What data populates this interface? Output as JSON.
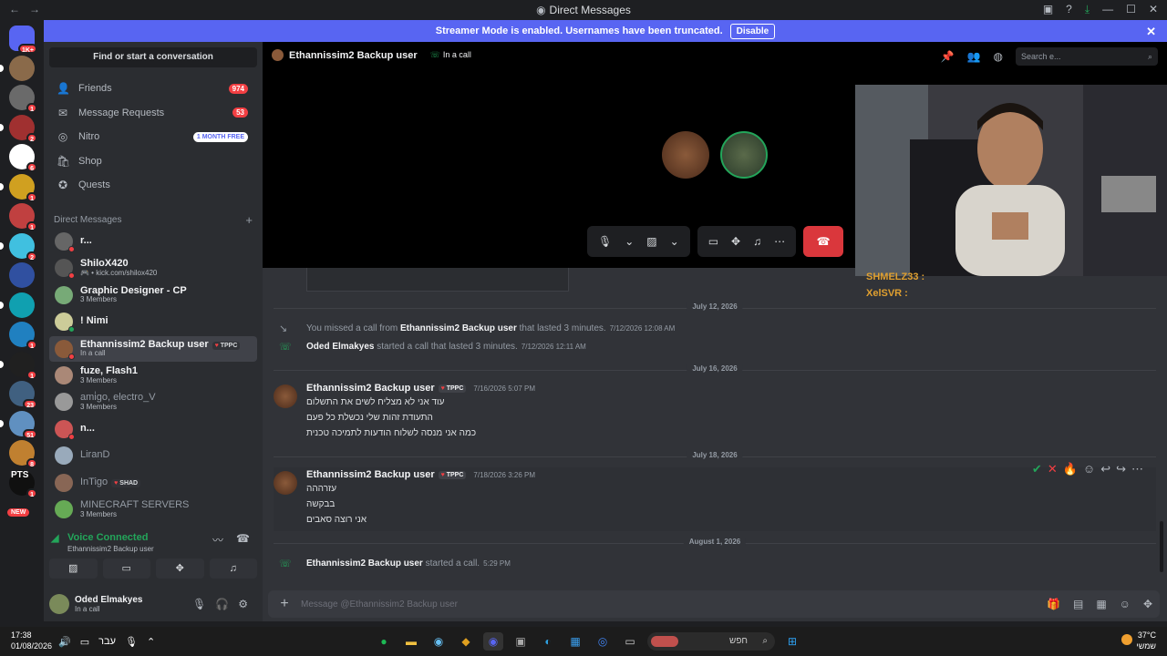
{
  "titlebar": {
    "title": "Direct Messages",
    "title_icon": "discord-icon",
    "nav_back": "←",
    "nav_fwd": "→"
  },
  "banner": {
    "text": "Streamer Mode is enabled. Usernames have been truncated.",
    "button": "Disable"
  },
  "servers": [
    {
      "badge": "1K+",
      "color": "#5865f2"
    },
    {
      "badge": "",
      "color": "#8a6a4a"
    },
    {
      "badge": "1",
      "color": "#6a6a6a"
    },
    {
      "badge": "2",
      "color": "#a03030"
    },
    {
      "badge": "6",
      "color": "#ffffff"
    },
    {
      "badge": "1",
      "color": "#d0a020"
    },
    {
      "badge": "1",
      "color": "#c04040"
    },
    {
      "badge": "2",
      "color": "#40c0e0"
    },
    {
      "badge": "",
      "color": "#3050a0"
    },
    {
      "badge": "",
      "color": "#10a0b0"
    },
    {
      "badge": "1",
      "color": "#2080c0"
    },
    {
      "badge": "1",
      "color": "#202020"
    },
    {
      "badge": "23",
      "color": "#406080"
    },
    {
      "badge": "51",
      "color": "#6090c0"
    },
    {
      "badge": "8",
      "color": "#c08030"
    },
    {
      "badge": "1",
      "color": "#101010"
    }
  ],
  "servers_pts": "PTS",
  "servers_new": "NEW",
  "sidebar": {
    "find": "Find or start a conversation",
    "nav": [
      {
        "label": "Friends",
        "icon": "friends-icon",
        "glyph": "👤",
        "count": "974"
      },
      {
        "label": "Message Requests",
        "icon": "mail-icon",
        "glyph": "✉",
        "count": "53"
      },
      {
        "label": "Nitro",
        "icon": "nitro-icon",
        "glyph": "◎",
        "promo": "1 MONTH FREE"
      },
      {
        "label": "Shop",
        "icon": "shop-icon",
        "glyph": "🛍"
      },
      {
        "label": "Quests",
        "icon": "quests-icon",
        "glyph": "✪"
      }
    ],
    "dm_header": "Direct Messages",
    "dms": [
      {
        "name": "r...",
        "sub": "",
        "color": "#666",
        "status": "#f23f43"
      },
      {
        "name": "ShiloX420",
        "sub": "🎮 • kick.com/shilox420",
        "color": "#555",
        "status": "#f23f43"
      },
      {
        "name": "Graphic Designer - CP",
        "sub": "3 Members",
        "color": "#7a7",
        "status": ""
      },
      {
        "name": "! Nimi",
        "sub": "",
        "color": "#cc9",
        "status": "#23a55a"
      },
      {
        "name": "Ethannissim2 Backup user",
        "sub": "In a call",
        "color": "#8a5a3a",
        "status": "#f23f43",
        "tag": "TPPC",
        "selected": true
      },
      {
        "name": "fuze, Flash1",
        "sub": "3 Members",
        "color": "#a87",
        "status": ""
      },
      {
        "name": "ami̇go, electro_V",
        "sub": "3 Members",
        "color": "#999",
        "status": "",
        "dim": true
      },
      {
        "name": "n...",
        "sub": "",
        "color": "#c55",
        "status": "#f23f43"
      },
      {
        "name": "LiranD",
        "sub": "",
        "color": "#9ab",
        "status": "",
        "dim": true
      },
      {
        "name": "InTigo",
        "sub": "",
        "color": "#865",
        "status": "",
        "dim": true,
        "tag": "SHAD"
      },
      {
        "name": "MINECRAFT SERVERS",
        "sub": "3 Members",
        "color": "#6a5",
        "status": "",
        "dim": true
      }
    ],
    "voice": {
      "status": "Voice Connected",
      "channel": "Ethannissim2 Backup user"
    },
    "user": {
      "name": "Oded Elmakyes",
      "sub": "In a call"
    }
  },
  "channel": {
    "name": "Ethannissim2 Backup user",
    "status": "In a call",
    "search_placeholder": "Search e..."
  },
  "stream_chat": [
    {
      "name": "SHMELZ33 :"
    },
    {
      "name": "XelSVR :"
    }
  ],
  "messages": {
    "date1": "July 12, 2026",
    "missed": {
      "pre": "You missed a call from",
      "who": "Ethannissim2 Backup user",
      "post": "that lasted 3 minutes.",
      "ts": "7/12/2026 12:08 AM"
    },
    "started": {
      "who": "Oded Elmakyes",
      "post": "started a call that lasted 3 minutes.",
      "ts": "7/12/2026 12:11 AM"
    },
    "date2": "July 16, 2026",
    "msg1": {
      "author": "Ethannissim2 Backup user",
      "tag": "TPPC",
      "ts": "7/16/2026 5:07 PM",
      "lines": [
        "עוד אני לא מצליח לשים את התשלום",
        "התעודת זהות שלי נכשלת כל פעם",
        "כמה אני מנסה לשלוח הודעות לתמיכה טכנית"
      ]
    },
    "date3": "July 18, 2026",
    "msg2": {
      "author": "Ethannissim2 Backup user",
      "tag": "TPPC",
      "ts": "7/18/2026 3:26 PM",
      "lines": [
        "עזרההה",
        "בבקשה",
        "אני רוצה סאבים"
      ]
    },
    "date4": "August 1, 2026",
    "call": {
      "who": "Ethannissim2 Backup user",
      "post": "started a call.",
      "ts": "5:29 PM"
    }
  },
  "composer": {
    "placeholder": "Message @Ethannissim2 Backup user"
  },
  "taskbar": {
    "time": "17:38",
    "date": "01/08/2026",
    "lang": "עבר",
    "search": "חפש",
    "temp": "37°C",
    "weather": "שמשי"
  }
}
